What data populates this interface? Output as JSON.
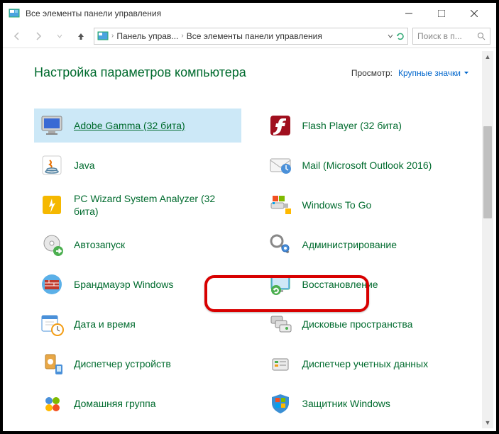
{
  "window": {
    "title": "Все элементы панели управления"
  },
  "breadcrumb": {
    "crumb1": "Панель управ...",
    "crumb2": "Все элементы панели управления"
  },
  "search": {
    "placeholder": "Поиск в п..."
  },
  "header": {
    "title": "Настройка параметров компьютера",
    "view_label": "Просмотр:",
    "view_value": "Крупные значки"
  },
  "items": [
    {
      "label": "Adobe Gamma (32 бита)",
      "icon": "adobe-gamma"
    },
    {
      "label": "Flash Player (32 бита)",
      "icon": "flash"
    },
    {
      "label": "Java",
      "icon": "java"
    },
    {
      "label": "Mail (Microsoft Outlook 2016)",
      "icon": "mail"
    },
    {
      "label": "PC Wizard System Analyzer (32 бита)",
      "icon": "pcwizard"
    },
    {
      "label": "Windows To Go",
      "icon": "wtg"
    },
    {
      "label": "Автозапуск",
      "icon": "autoplay"
    },
    {
      "label": "Администрирование",
      "icon": "admin"
    },
    {
      "label": "Брандмауэр Windows",
      "icon": "firewall"
    },
    {
      "label": "Восстановление",
      "icon": "recovery"
    },
    {
      "label": "Дата и время",
      "icon": "datetime"
    },
    {
      "label": "Дисковые пространства",
      "icon": "storage"
    },
    {
      "label": "Диспетчер устройств",
      "icon": "devmgr"
    },
    {
      "label": "Диспетчер учетных данных",
      "icon": "credmgr"
    },
    {
      "label": "Домашняя группа",
      "icon": "homegroup"
    },
    {
      "label": "Защитник Windows",
      "icon": "defender"
    }
  ]
}
